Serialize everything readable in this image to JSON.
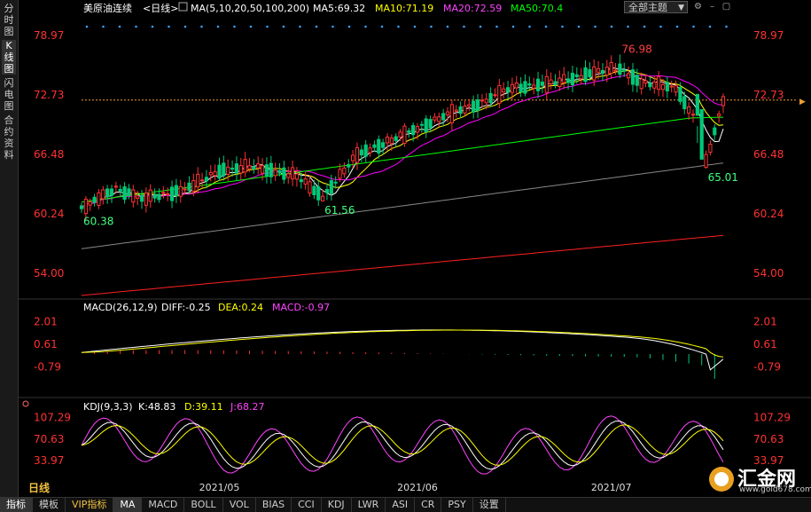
{
  "left_tabs": [
    "分时图",
    "K线图",
    "闪电图",
    "合约资料"
  ],
  "left_tab_active": 1,
  "main_panel": {
    "symbol": "美原油连续",
    "period": "<日线>",
    "ma_label": "MA(5,10,20,50,100,200)",
    "ma5": "MA5:69.32",
    "ma10": "MA10:71.19",
    "ma20": "MA20:72.59",
    "ma50": "MA50:70.4",
    "theme": "全部主题"
  },
  "macd_panel": {
    "title": "MACD(26,12,9)",
    "diff": "DIFF:-0.25",
    "dea": "DEA:0.24",
    "macd": "MACD:-0.97"
  },
  "kdj_panel": {
    "title": "KDJ(9,3,3)",
    "k": "K:48.83",
    "d": "D:39.11",
    "j": "J:68.27"
  },
  "colors": {
    "up": "#ff3232",
    "down": "#00c878",
    "ma5": "#ffffff",
    "ma10": "#ffff00",
    "ma20": "#ff00ff",
    "ma50": "#00ff00",
    "ma100": "#888888",
    "ma200": "#ff2020",
    "grid_label": "#ff3232",
    "current_line": "#f0a030"
  },
  "period_label": "日线",
  "bottom_tabs": [
    "指标",
    "模板",
    "VIP指标",
    "MA",
    "MACD",
    "BOLL",
    "VOL",
    "BIAS",
    "CCI",
    "KDJ",
    "LWR",
    "ASI",
    "CR",
    "PSY",
    "设置"
  ],
  "bottom_active": [
    "指标",
    "MA"
  ],
  "logo": {
    "name": "汇金网",
    "url": "www.gold678.com"
  },
  "chart_data": [
    {
      "type": "candlestick",
      "y_ticks": [
        78.97,
        72.73,
        66.48,
        60.24,
        54.0
      ],
      "ylim": [
        51.6,
        81.4
      ],
      "x_labels": [
        {
          "label": "2021/05",
          "index": 32
        },
        {
          "label": "2021/06",
          "index": 78
        },
        {
          "label": "2021/07",
          "index": 123
        }
      ],
      "annotations": [
        {
          "text": "60.38",
          "index": 0,
          "value": 60.38,
          "pos": "below"
        },
        {
          "text": "61.56",
          "index": 56,
          "value": 61.56,
          "pos": "below"
        },
        {
          "text": "76.98",
          "index": 125,
          "value": 76.98,
          "pos": "above"
        },
        {
          "text": "65.01",
          "index": 145,
          "value": 65.01,
          "pos": "below"
        }
      ],
      "current_price": 72.2
    },
    {
      "type": "macd",
      "y_ticks": [
        2.01,
        0.61,
        -0.79
      ],
      "ylim": [
        -2.6,
        2.6
      ]
    },
    {
      "type": "kdj",
      "y_ticks": [
        107.29,
        70.63,
        33.97
      ],
      "ylim": [
        -5,
        120
      ]
    }
  ]
}
